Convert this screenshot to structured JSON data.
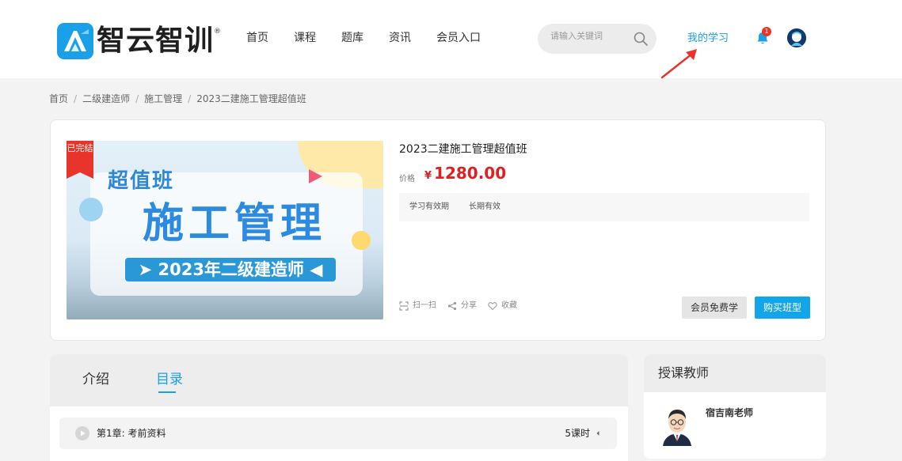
{
  "header": {
    "logo_text": "智云智训",
    "logo_reg": "®",
    "nav": [
      "首页",
      "课程",
      "题库",
      "资讯",
      "会员入口"
    ],
    "search_placeholder": "请输入关键词",
    "my_learning": "我的学习",
    "notification_count": "1"
  },
  "breadcrumb": [
    "首页",
    "二级建造师",
    "施工管理",
    "2023二建施工管理超值班"
  ],
  "course": {
    "status_ribbon": "已完结",
    "cover": {
      "subtitle": "超值班",
      "main_title": "施工管理",
      "bar_text": "➤ 2023年二级建造师 ◀"
    },
    "title": "2023二建施工管理超值班",
    "price_label": "价格",
    "currency": "¥",
    "price": "1280.00",
    "validity_label": "学习有效期",
    "validity_value": "长期有效",
    "actions": {
      "scan": "扫一扫",
      "share": "分享",
      "favorite": "收藏"
    },
    "btn_member": "会员免费学",
    "btn_buy": "购买班型"
  },
  "tabs": {
    "intro": "介绍",
    "catalog": "目录",
    "active": "目录"
  },
  "catalog": [
    {
      "title": "第1章: 考前资料",
      "count": "5课时"
    }
  ],
  "teacher": {
    "heading": "授课教师",
    "name": "宿吉南老师"
  },
  "colors": {
    "accent": "#1aa0e8",
    "price": "#e02020",
    "buy_button": "#12a5ea",
    "ribbon": "#e8342a"
  }
}
